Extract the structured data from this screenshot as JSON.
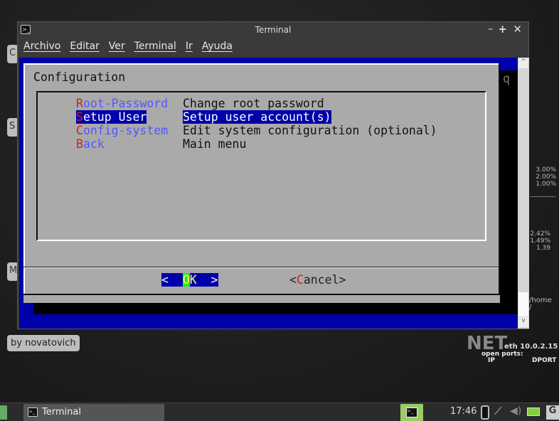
{
  "window": {
    "title": "Terminal",
    "menu": [
      "Archivo",
      "Editar",
      "Ver",
      "Terminal",
      "Ir",
      "Ayuda"
    ]
  },
  "dialog": {
    "title": "Configuration",
    "items": [
      {
        "key": "R",
        "rest": "oot-Password",
        "desc": "Change root password",
        "selected": false
      },
      {
        "key": "S",
        "rest": "etup User",
        "desc": "Setup user account(s)",
        "selected": true
      },
      {
        "key": "C",
        "rest": "onfig-system",
        "desc": "Edit system configuration (optional)",
        "selected": false
      },
      {
        "key": "B",
        "rest": "ack",
        "desc": "Main menu",
        "selected": false
      }
    ],
    "ok": {
      "left": "<  ",
      "key": "O",
      "rest": "K",
      "right": "  >"
    },
    "cancel": {
      "open": "<",
      "key": "C",
      "rest": "ancel",
      "close": ">"
    },
    "bg_char": "q"
  },
  "desktop": {
    "credit": "by novatovich",
    "side_tabs": [
      "C",
      "S",
      "M"
    ],
    "cpu": [
      "3.00%",
      "2.00%",
      "1.00%"
    ],
    "load": [
      "2.42%",
      "1.49%",
      "1.39"
    ],
    "disk": [
      "/home",
      "/"
    ],
    "net": {
      "label": "NET",
      "iface": "eth 10.0.2.15",
      "open_ports": "open ports:",
      "ip": "IP",
      "dport": "DPORT"
    }
  },
  "taskbar": {
    "task": "Terminal",
    "clock": "17:46"
  },
  "colors": {
    "dialog_bg": "#aaaaaa",
    "term_blue": "#0000aa",
    "hotkey_red": "#cc2222",
    "item_blue": "#5555ff",
    "ok_green": "#22ee22"
  }
}
